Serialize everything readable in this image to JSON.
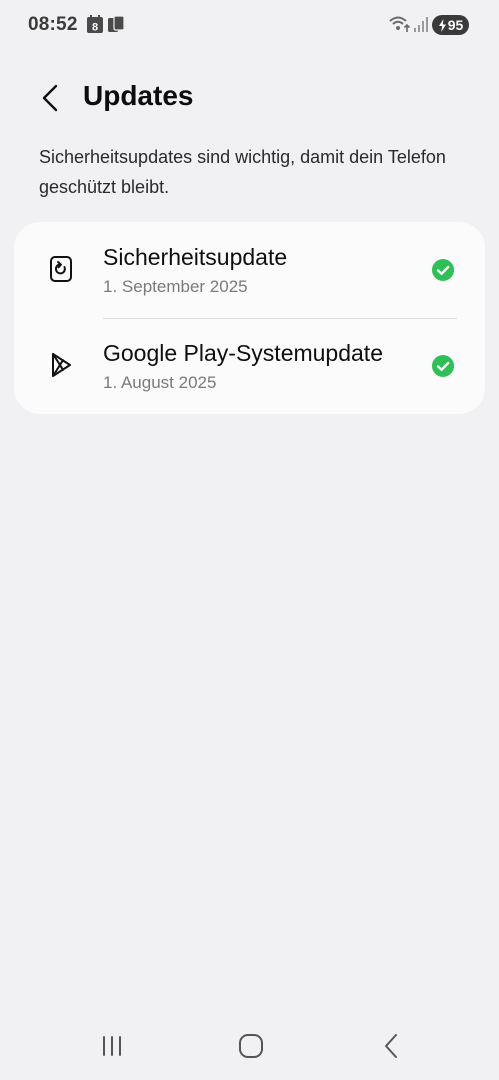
{
  "status_bar": {
    "time": "08:52",
    "calendar_day": "8",
    "battery_level": "95",
    "icons": [
      "calendar-icon",
      "sim-icon",
      "wifi-icon",
      "signal-icon",
      "battery-charging-icon"
    ]
  },
  "header": {
    "title": "Updates"
  },
  "description": "Sicherheitsupdates sind wichtig, damit dein Telefon geschützt bleibt.",
  "updates": [
    {
      "title": "Sicherheitsupdate",
      "date": "1. September 2025",
      "icon": "security-update-icon",
      "status": "check-icon"
    },
    {
      "title": "Google Play-Systemupdate",
      "date": "1. August 2025",
      "icon": "google-play-icon",
      "status": "check-icon"
    }
  ],
  "colors": {
    "background": "#f1f1f3",
    "card": "#fbfbfc",
    "check_green": "#2fbf57"
  },
  "nav": [
    "recent-apps-icon",
    "home-icon",
    "back-icon"
  ]
}
